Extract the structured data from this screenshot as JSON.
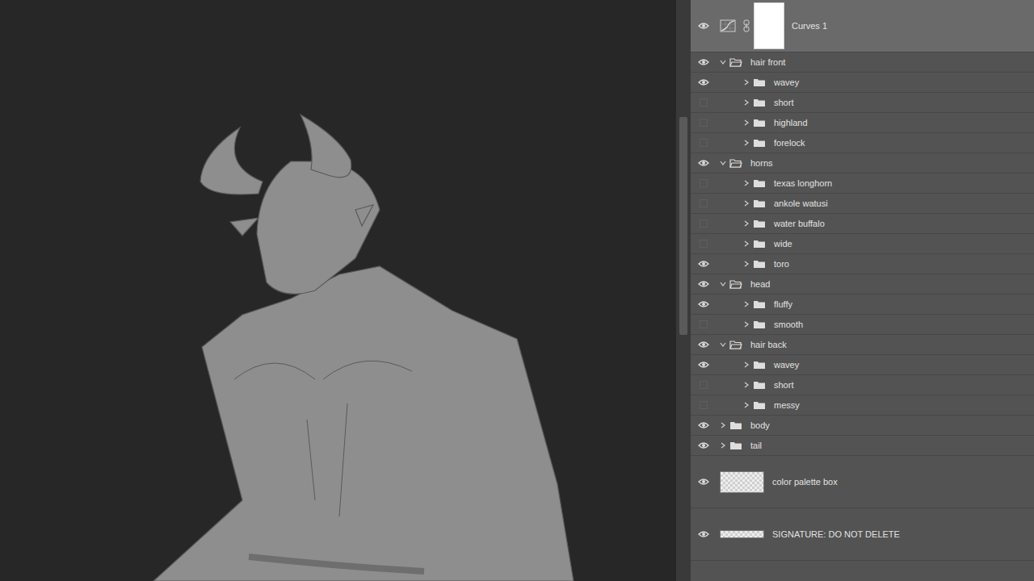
{
  "layers": [
    {
      "name": "Curves 1",
      "kind": "adjustment",
      "depth": 0,
      "visible": true,
      "expanded": false,
      "selected": true
    },
    {
      "name": "hair front",
      "kind": "group",
      "depth": 0,
      "visible": true,
      "expanded": true,
      "selected": false
    },
    {
      "name": "wavey",
      "kind": "group",
      "depth": 1,
      "visible": true,
      "expanded": false,
      "selected": false
    },
    {
      "name": "short",
      "kind": "group",
      "depth": 1,
      "visible": false,
      "expanded": false,
      "selected": false
    },
    {
      "name": "highland",
      "kind": "group",
      "depth": 1,
      "visible": false,
      "expanded": false,
      "selected": false
    },
    {
      "name": "forelock",
      "kind": "group",
      "depth": 1,
      "visible": false,
      "expanded": false,
      "selected": false
    },
    {
      "name": "horns",
      "kind": "group",
      "depth": 0,
      "visible": true,
      "expanded": true,
      "selected": false
    },
    {
      "name": "texas longhorn",
      "kind": "group",
      "depth": 1,
      "visible": false,
      "expanded": false,
      "selected": false
    },
    {
      "name": "ankole watusi",
      "kind": "group",
      "depth": 1,
      "visible": false,
      "expanded": false,
      "selected": false
    },
    {
      "name": "water buffalo",
      "kind": "group",
      "depth": 1,
      "visible": false,
      "expanded": false,
      "selected": false
    },
    {
      "name": "wide",
      "kind": "group",
      "depth": 1,
      "visible": false,
      "expanded": false,
      "selected": false
    },
    {
      "name": "toro",
      "kind": "group",
      "depth": 1,
      "visible": true,
      "expanded": false,
      "selected": false
    },
    {
      "name": "head",
      "kind": "group",
      "depth": 0,
      "visible": true,
      "expanded": true,
      "selected": false
    },
    {
      "name": "fluffy",
      "kind": "group",
      "depth": 1,
      "visible": true,
      "expanded": false,
      "selected": false
    },
    {
      "name": "smooth",
      "kind": "group",
      "depth": 1,
      "visible": false,
      "expanded": false,
      "selected": false
    },
    {
      "name": "hair back",
      "kind": "group",
      "depth": 0,
      "visible": true,
      "expanded": true,
      "selected": false
    },
    {
      "name": "wavey",
      "kind": "group",
      "depth": 1,
      "visible": true,
      "expanded": false,
      "selected": false
    },
    {
      "name": "short",
      "kind": "group",
      "depth": 1,
      "visible": false,
      "expanded": false,
      "selected": false
    },
    {
      "name": "messy",
      "kind": "group",
      "depth": 1,
      "visible": false,
      "expanded": false,
      "selected": false
    },
    {
      "name": "body",
      "kind": "group",
      "depth": 0,
      "visible": true,
      "expanded": false,
      "selected": false
    },
    {
      "name": "tail",
      "kind": "group",
      "depth": 0,
      "visible": true,
      "expanded": false,
      "selected": false
    },
    {
      "name": "color palette box",
      "kind": "layer",
      "depth": 0,
      "visible": true,
      "expanded": false,
      "selected": false
    },
    {
      "name": "SIGNATURE: DO NOT DELETE",
      "kind": "signature",
      "depth": 0,
      "visible": true,
      "expanded": false,
      "selected": false
    }
  ]
}
